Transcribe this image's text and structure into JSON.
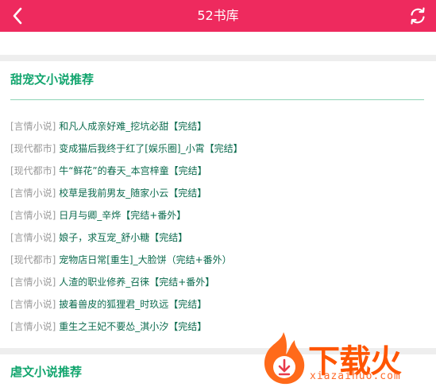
{
  "header": {
    "title": "52书库",
    "back_icon": "chevron-left-icon",
    "refresh_icon": "refresh-icon",
    "color": "#ee2a5e"
  },
  "sections": [
    {
      "heading": "甜宠文小说推荐",
      "books": [
        {
          "category": "[言情小说]",
          "title": "和凡人成亲好难_挖坑必甜【完结】"
        },
        {
          "category": "[现代都市]",
          "title": "变成猫后我终于红了[娱乐圈]_小霄【完结】"
        },
        {
          "category": "[现代都市]",
          "title": "牛“鲜花”的春天_本宫梓童【完结】"
        },
        {
          "category": "[言情小说]",
          "title": "校草是我前男友_随家小云【完结】"
        },
        {
          "category": "[言情小说]",
          "title": "日月与卿_辛烨【完结+番外】"
        },
        {
          "category": "[言情小说]",
          "title": "娘子，求互宠_舒小糖【完结】"
        },
        {
          "category": "[现代都市]",
          "title": "宠物店日常[重生]_大脸饼（完结+番外）"
        },
        {
          "category": "[言情小说]",
          "title": "人渣的职业修养_召徕【完结+番外】"
        },
        {
          "category": "[言情小说]",
          "title": "披着兽皮的狐狸君_时玖远【完结】"
        },
        {
          "category": "[言情小说]",
          "title": "重生之王妃不要怂_淇小汐【完结】"
        }
      ]
    },
    {
      "heading": "虐文小说推荐",
      "books": []
    }
  ],
  "watermark": {
    "word": "下载火",
    "domain": "xiazaihuo.com",
    "color": "#ff5500"
  }
}
